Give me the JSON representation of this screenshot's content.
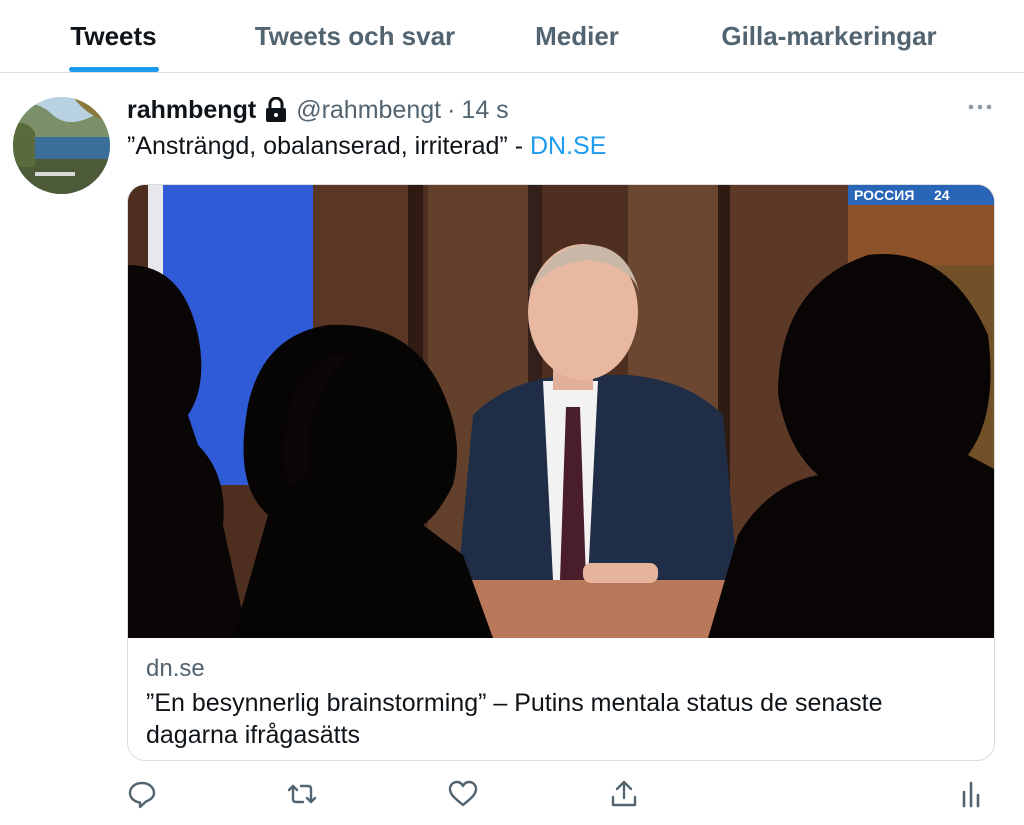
{
  "tabs": [
    {
      "label": "Tweets",
      "active": true
    },
    {
      "label": "Tweets och svar",
      "active": false
    },
    {
      "label": "Medier",
      "active": false
    },
    {
      "label": "Gilla-markeringar",
      "active": false
    }
  ],
  "tweet": {
    "display_name": "rahmbengt",
    "handle": "@rahmbengt",
    "separator": "·",
    "time": "14 s",
    "text": "”Ansträngd, obalanserad, irriterad” - ",
    "link_text": "DN.SE",
    "card": {
      "channel_logo": "РОССИЯ",
      "channel_number": "24",
      "domain": "dn.se",
      "title": "”En besynnerlig brainstorming” – Putins mentala status de senaste dagarna ifrågasätts"
    }
  },
  "icons": {
    "lock": "lock-icon",
    "more": "more-icon",
    "reply": "reply-icon",
    "retweet": "retweet-icon",
    "like": "heart-icon",
    "share": "share-icon",
    "analytics": "analytics-icon"
  },
  "colors": {
    "accent": "#1d9bf0",
    "text_primary": "#0f1419",
    "text_secondary": "#536471",
    "border": "#d9dde0"
  }
}
